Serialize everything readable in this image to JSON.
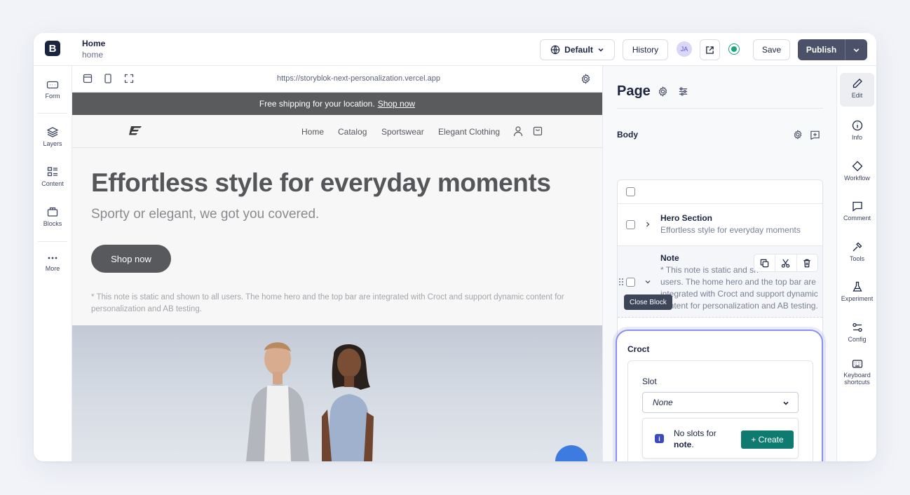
{
  "topbar": {
    "logo_letter": "B",
    "story_title": "Home",
    "story_slug": "home",
    "language": "Default",
    "history": "History",
    "avatar_initials": "JA",
    "save": "Save",
    "publish": "Publish"
  },
  "leftnav": [
    {
      "label": "Form",
      "icon": "form-icon"
    },
    {
      "label": "Layers",
      "icon": "layers-icon"
    },
    {
      "label": "Content",
      "icon": "content-icon"
    },
    {
      "label": "Blocks",
      "icon": "blocks-icon"
    },
    {
      "label": "More",
      "icon": "more-icon"
    }
  ],
  "preview": {
    "url": "https://storyblok-next-personalization.vercel.app",
    "promo_text": "Free shipping for your location.",
    "promo_link": "Shop now",
    "nav": [
      "Home",
      "Catalog",
      "Sportswear",
      "Elegant Clothing"
    ],
    "hero_title": "Effortless style for everyday moments",
    "hero_subtitle": "Sporty or elegant, we got you covered.",
    "hero_button": "Shop now",
    "note": "* This note is static and shown to all users. The home hero and the top bar are integrated with Croct and support dynamic content for personalization and AB testing."
  },
  "editor": {
    "page_title": "Page",
    "body_label": "Body",
    "blocks": [
      {
        "title": "Hero Section",
        "subtitle": "Effortless style for everyday moments"
      },
      {
        "title": "Note",
        "line1": "* This note is static and sh",
        "line2": "users. The home hero and the top bar are",
        "line3": "integrated with Croct and support dynamic",
        "line4": "content for personalization and AB testing."
      }
    ],
    "tooltip": "Close Block",
    "croct": {
      "title": "Croct",
      "slot_label": "Slot",
      "slot_value": "None",
      "info_line1": "No slots for",
      "info_bold": "note",
      "info_period": ".",
      "create_button": "+ Create"
    }
  },
  "rightbar": [
    {
      "label": "Edit",
      "icon": "pencil-icon"
    },
    {
      "label": "Info",
      "icon": "info-icon"
    },
    {
      "label": "Workflow",
      "icon": "workflow-icon"
    },
    {
      "label": "Comment",
      "icon": "comment-icon"
    },
    {
      "label": "Tools",
      "icon": "tools-icon"
    },
    {
      "label": "Experiment",
      "icon": "flask-icon"
    },
    {
      "label": "Config",
      "icon": "config-icon"
    },
    {
      "label": "Keyboard shortcuts",
      "icon": "keyboard-icon"
    }
  ],
  "colors": {
    "brand_dark": "#1b243f",
    "publish_bg": "#4a5169",
    "create_green": "#0f7a6f",
    "highlight": "#8b8ff0",
    "status_green": "#1fa37f"
  }
}
